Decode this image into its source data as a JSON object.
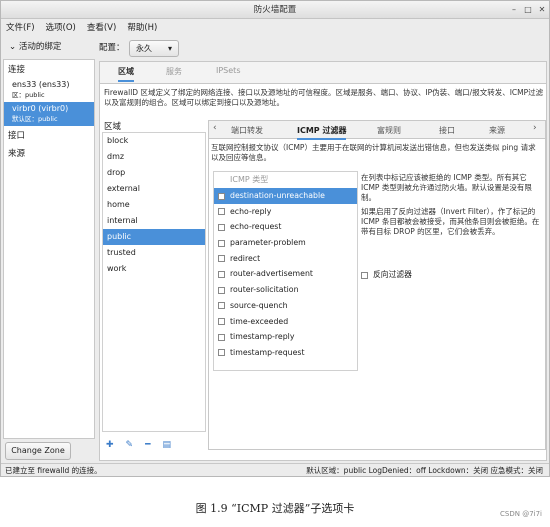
{
  "window": {
    "title": "防火墙配置"
  },
  "menu": [
    "文件(F)",
    "选项(O)",
    "查看(V)",
    "帮助(H)"
  ],
  "left": {
    "active_bindings_label": "活动的绑定",
    "connections_header": "连接",
    "bindings": [
      {
        "name": "ens33 (ens33)",
        "zone": "区：public"
      },
      {
        "name": "virbr0 (virbr0)",
        "zone": "默认区：public"
      }
    ],
    "interfaces_header": "接口",
    "sources_header": "来源",
    "change_zone": "Change Zone"
  },
  "config": {
    "label": "配置：",
    "value": "永久"
  },
  "top_tabs": [
    "区域",
    "服务",
    "IPSets"
  ],
  "zone_desc": "FirewallD 区域定义了绑定的网络连接、接口以及源地址的可信程度。区域是服务、端口、协议、IP伪装、端口/报文转发、ICMP过滤以及富规则的组合。区域可以绑定到接口以及源地址。",
  "zones_label": "区域",
  "zones": [
    "block",
    "dmz",
    "drop",
    "external",
    "home",
    "internal",
    "public",
    "trusted",
    "work"
  ],
  "sub_tabs": [
    "端口转发",
    "ICMP 过滤器",
    "富规则",
    "接口",
    "来源"
  ],
  "icmp_desc": "互联网控制报文协议（ICMP）主要用于在联网的计算机间发送出错信息，但也发送类似 ping 请求以及回应等信息。",
  "icmp_type_header": "ICMP 类型",
  "icmp_types": [
    "destination-unreachable",
    "echo-reply",
    "echo-request",
    "parameter-problem",
    "redirect",
    "router-advertisement",
    "router-solicitation",
    "source-quench",
    "time-exceeded",
    "timestamp-reply",
    "timestamp-request"
  ],
  "side_note_1": "在列表中标记应该被拒绝的 ICMP 类型。所有其它 ICMP 类型则被允许通过防火墙。默认设置是没有限制。",
  "side_note_2": "如果启用了反向过滤器（Invert Filter），作了标记的 ICMP 条目都被会被接受，而其他条目则会被拒绝。在带有目标 DROP 的区里，它们会被丢弃。",
  "invert_label": "反向过滤器",
  "status": {
    "left": "已建立至 firewalld 的连接。",
    "right": "默认区域：public  LogDenied：off  Lockdown：关闭  应急模式：关闭"
  },
  "caption": "图 1.9 “ICMP 过滤器”子选项卡",
  "watermark": "CSDN @7i7i"
}
